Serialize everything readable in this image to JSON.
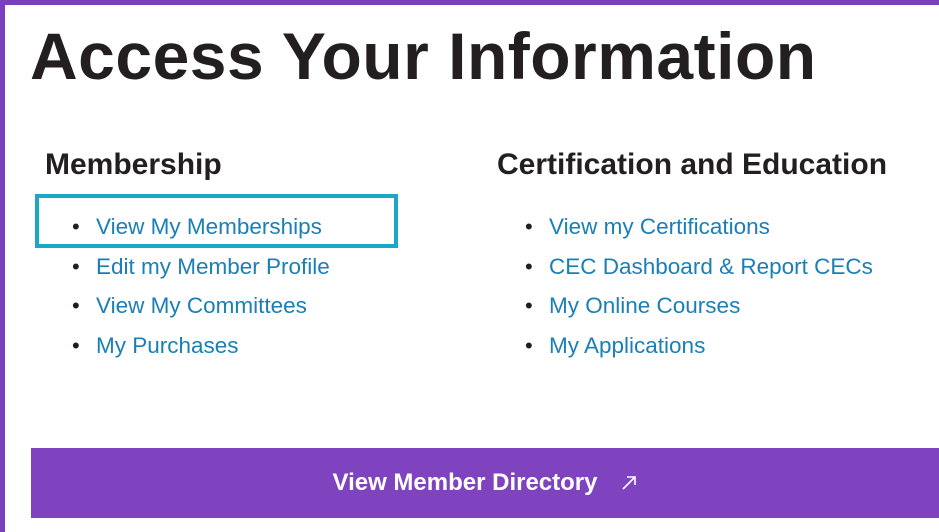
{
  "title": "Access Your Information",
  "membership": {
    "heading": "Membership",
    "items": [
      {
        "label": "View My Memberships"
      },
      {
        "label": "Edit my Member Profile"
      },
      {
        "label": "View My Committees"
      },
      {
        "label": "My Purchases"
      }
    ]
  },
  "certification": {
    "heading": "Certification and Education",
    "items": [
      {
        "label": "View my Certifications"
      },
      {
        "label": "CEC Dashboard & Report CECs"
      },
      {
        "label": "My Online Courses"
      },
      {
        "label": "My Applications"
      }
    ]
  },
  "directory_button": {
    "label": "View Member Directory",
    "icon": "external-link-arrow-icon"
  },
  "colors": {
    "accent_purple": "#7f43c0",
    "link_blue": "#1a7fb5",
    "highlight_teal": "#1ba8c7",
    "heading_dark": "#231f20"
  }
}
